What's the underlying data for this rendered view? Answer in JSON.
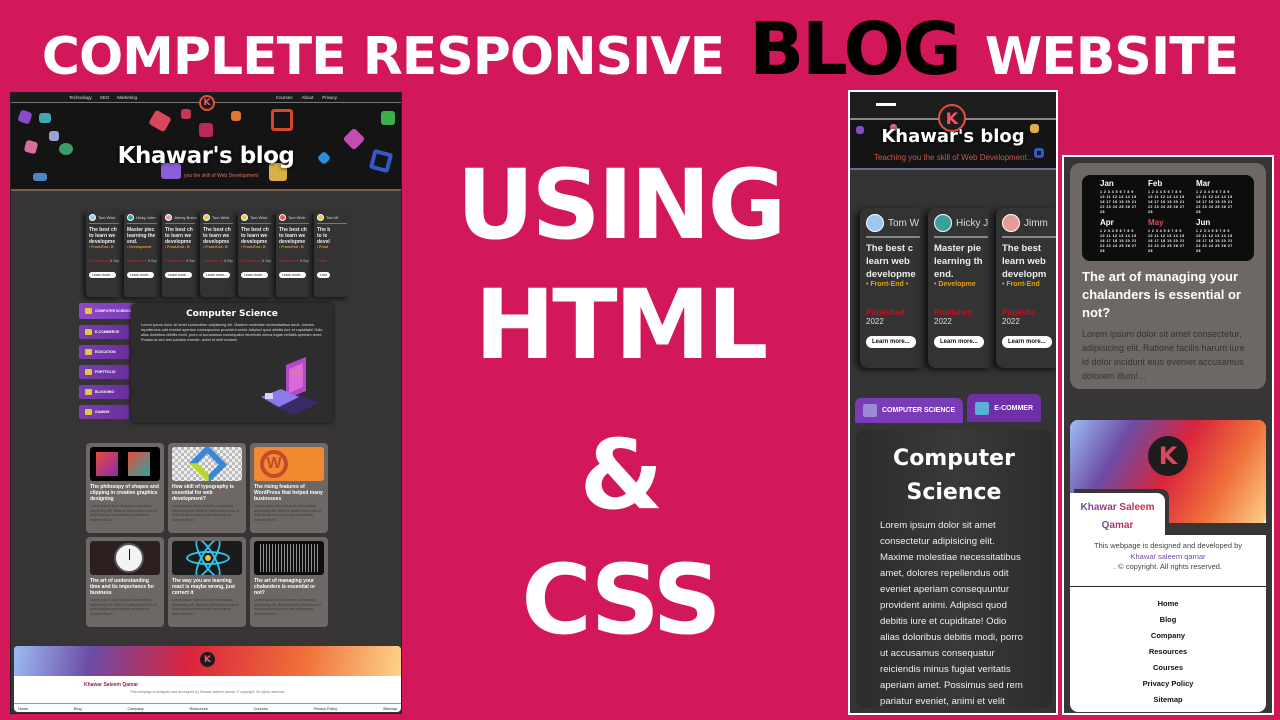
{
  "headline": {
    "part1": "COMPLETE RESPONSIVE",
    "highlight": "BLOG",
    "part2": "WEBSITE"
  },
  "center_text": {
    "line1": "USING",
    "line2": "HTML",
    "line3": "&",
    "line4": "CSS"
  },
  "colors": {
    "background": "#d2175a",
    "accent_purple": "#7a3bb7",
    "tag_orange": "#e0a020",
    "published_red": "#c1121f"
  },
  "site": {
    "logo_letter": "K",
    "title": "Khawar's blog",
    "subtitle": "Teaching you the skill of Web Development...",
    "subtitle_short": "you the skill of Web Development",
    "nav_left": [
      "Technology",
      "SEO",
      "Marketing"
    ],
    "nav_right": [
      "Courses",
      "About",
      "Privacy"
    ],
    "menu_icon": "hamburger-icon"
  },
  "cards": [
    {
      "author": "Tom Wick",
      "title_lines": [
        "The best ch",
        "to learn we",
        "developme"
      ],
      "tag": "• Front-End • B",
      "published": "Published on",
      "date": "8 Sep",
      "button": "Learn more..."
    },
    {
      "author": "Hicky John",
      "title_lines": [
        "Master piec",
        "learning the",
        "end."
      ],
      "tag": "• Development",
      "published": "Published on",
      "date": "8 Sep",
      "button": "Learn more..."
    },
    {
      "author": "Jimmy Bucer",
      "title_lines": [
        "The best ch",
        "to learn we",
        "developme"
      ],
      "tag": "• Front-End • B",
      "published": "Published on",
      "date": "8 Sep",
      "button": "Learn more..."
    },
    {
      "author": "Tom Wick",
      "title_lines": [
        "The best ch",
        "to learn we",
        "developme"
      ],
      "tag": "• Front-End • B",
      "published": "Published on",
      "date": "8 Sep",
      "button": "Learn more..."
    },
    {
      "author": "Tom Wick",
      "title_lines": [
        "The best ch",
        "to learn we",
        "developme"
      ],
      "tag": "• Front-End • B",
      "published": "Published on",
      "date": "8 Sep",
      "button": "Learn more..."
    },
    {
      "author": "Tom Wick",
      "title_lines": [
        "The best ch",
        "to learn we",
        "developme"
      ],
      "tag": "• Front-End • B",
      "published": "Published on",
      "date": "8 Sep",
      "button": "Learn more..."
    },
    {
      "author": "Tom W",
      "title_lines": [
        "The b",
        "to le",
        "devel"
      ],
      "tag": "• Front",
      "published": "Publis",
      "date": "",
      "button": "Lear"
    }
  ],
  "tablet_cards": [
    {
      "author": "Tom W",
      "title_lines": [
        "The best c",
        "learn web",
        "developme"
      ],
      "tag": "• Front-End •",
      "published": "Published",
      "year": "2022",
      "button": "Learn more..."
    },
    {
      "author": "Hicky J",
      "title_lines": [
        "Master pie",
        "learning th",
        "end."
      ],
      "tag": "• Developme",
      "published": "Published",
      "year": "2022",
      "button": "Learn more..."
    },
    {
      "author": "Jimm",
      "title_lines": [
        "The best",
        "learn web",
        "developm"
      ],
      "tag": "• Front-End",
      "published": "Publishe",
      "year": "2022",
      "button": "Learn more..."
    }
  ],
  "categories": [
    {
      "label": "COMPUTER SCIENCE",
      "active": true
    },
    {
      "label": "E-COMMERCE",
      "active": false
    },
    {
      "label": "EDUCATION",
      "active": false
    },
    {
      "label": "PORTFOLIO",
      "active": false
    },
    {
      "label": "BLOGGING",
      "active": false
    },
    {
      "label": "GAMING",
      "active": false
    }
  ],
  "tablet_categories": [
    "COMPUTER SCIENCE",
    "E-COMMER"
  ],
  "section": {
    "title": "Computer Science",
    "title_line1": "Computer",
    "title_line2": "Science",
    "body": "Lorem ipsum dolor sit amet consectetur adipisicing elit. Maxime molestiae necessitatibus amet, dolores repellendus odit eveniet aperiam consequuntur provident animi. Adipisci quod debitis iure et cupiditate! Odio alias doloribus debitis modi, porro ut accusamus consequatur reiciendis minus fugiat veritatis aperiam amet. Possimus sed rem pariatur eveniet, animi et velit veniam!"
  },
  "posts": [
    {
      "title": "The philosopy of shapes and clipping in creative graphics designing",
      "excerpt": "Lorem ipsum dolor sit amet consectetur, adipisicing elit. Ratione facilis harum iure id dolor incidunt eius eveniet accusamus dolorem illum!...",
      "image": "shapes"
    },
    {
      "title": "How skill of typography is essential for web development?",
      "excerpt": "Lorem ipsum dolor sit amet consectetur, adipisicing elit. Ratione facilis harum iure id dolor incidunt eius eveniet accusamus dolorem illum!...",
      "image": "typography"
    },
    {
      "title": "The rising features of WordPress that helped many businesses",
      "excerpt": "Lorem ipsum dolor sit amet consectetur, adipisicing elit. Ratione facilis harum iure id dolor incidunt eius eveniet accusamus dolorem illum!...",
      "image": "wordpress"
    },
    {
      "title": "The art of understanding time and its importance for business",
      "excerpt": "Lorem ipsum dolor sit amet consectetur, adipisicing elit. Ratione facilis harum iure id dolor incidunt eius eveniet accusamus dolorem illum!...",
      "image": "clock"
    },
    {
      "title": "The way you are learning react is maybe wrong, just correct it",
      "excerpt": "Lorem ipsum dolor sit amet consectetur, adipisicing elit. Ratione facilis harum iure id dolor incidunt eius eveniet accusamus dolorem illum!...",
      "image": "react"
    },
    {
      "title": "The art of managing your chalanders is essential or not?",
      "excerpt": "Lorem ipsum dolor sit amet consectetur, adipisicing elit. Ratione facilis harum iure id dolor incidunt eius eveniet accusamus dolorem illum!...",
      "image": "calendar"
    }
  ],
  "calendar": {
    "months": [
      "Jan",
      "Feb",
      "Mar",
      "Apr",
      "May",
      "Jun"
    ],
    "highlight_month": "May"
  },
  "footer": {
    "name": "Khawar Saleem Qamar",
    "name_line1": "Khawar Saleem",
    "name_line2": "Qamar",
    "copyright": "This webpage is designed and developed by Khawar saleem qamar. © copyright. All rights reserved.",
    "copyright_pre": "This webpage is designed and developed by",
    "copyright_link": "Khawar saleem qamar",
    "copyright_post": ". © copyright. All rights reserved.",
    "links": [
      "Home",
      "Blog",
      "Company",
      "Resources",
      "Courses",
      "Privacy Policy",
      "Sitemap"
    ]
  }
}
